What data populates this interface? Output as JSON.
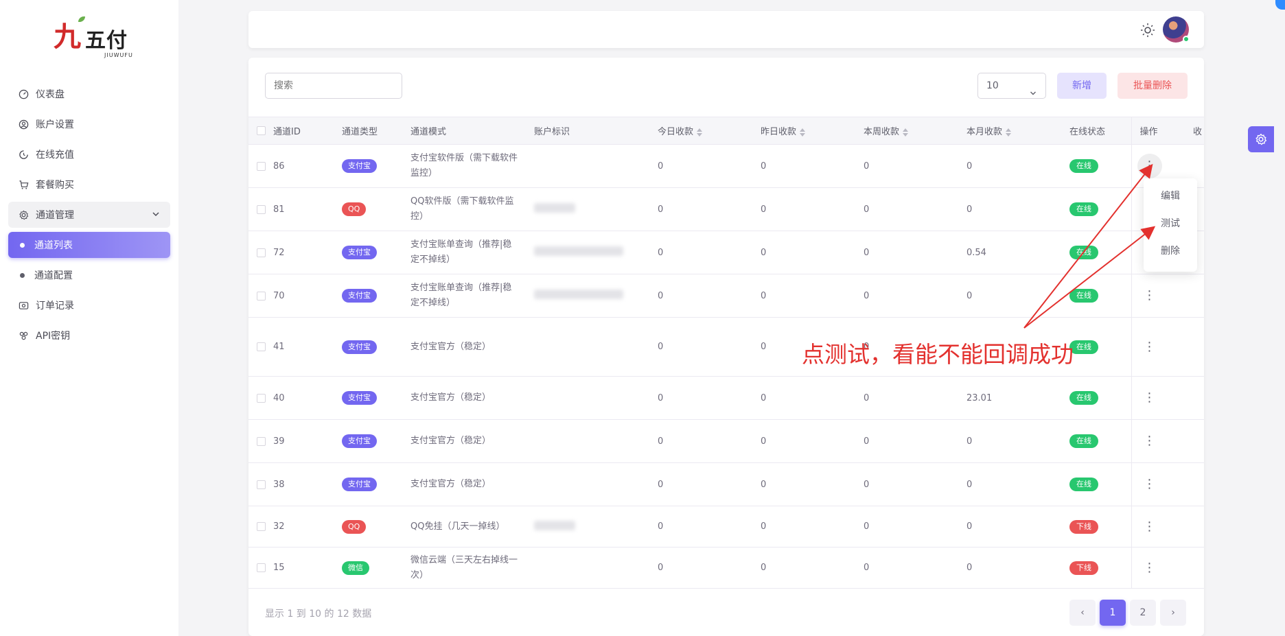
{
  "brand": {
    "mark": "九",
    "word": "五付",
    "sub": "JIUWUFU"
  },
  "sidebar": {
    "items": [
      {
        "label": "仪表盘",
        "icon": "dashboard-icon"
      },
      {
        "label": "账户设置",
        "icon": "user-icon"
      },
      {
        "label": "在线充值",
        "icon": "recharge-icon"
      },
      {
        "label": "套餐购买",
        "icon": "cart-icon"
      },
      {
        "label": "通道管理",
        "icon": "settings-icon"
      },
      {
        "label": "通道列表",
        "icon": "dot-icon"
      },
      {
        "label": "通道配置",
        "icon": "dot-icon"
      },
      {
        "label": "订单记录",
        "icon": "order-icon"
      },
      {
        "label": "API密钥",
        "icon": "api-icon"
      }
    ]
  },
  "toolbar": {
    "search_placeholder": "搜索",
    "page_size": "10",
    "add_label": "新增",
    "batch_delete_label": "批量删除"
  },
  "table": {
    "headers": {
      "id": "通道ID",
      "type": "通道类型",
      "mode": "通道模式",
      "account": "账户标识",
      "today": "今日收款",
      "yesterday": "昨日收款",
      "week": "本周收款",
      "month": "本月收款",
      "status": "在线状态",
      "action": "操作",
      "extra": "收"
    },
    "rows": [
      {
        "id": "86",
        "type": "支付宝",
        "mode": "支付宝软件版（需下载软件监控）",
        "today": "0",
        "yesterday": "0",
        "week": "0",
        "month": "0",
        "status": "在线"
      },
      {
        "id": "81",
        "type": "QQ",
        "mode": "QQ软件版（需下载软件监控）",
        "today": "0",
        "yesterday": "0",
        "week": "0",
        "month": "0",
        "status": "在线"
      },
      {
        "id": "72",
        "type": "支付宝",
        "mode": "支付宝账单查询（推荐|稳定不掉线）",
        "today": "0",
        "yesterday": "0",
        "week": "0",
        "month": "0.54",
        "status": "在线"
      },
      {
        "id": "70",
        "type": "支付宝",
        "mode": "支付宝账单查询（推荐|稳定不掉线）",
        "today": "0",
        "yesterday": "0",
        "week": "0",
        "month": "0",
        "status": "在线"
      },
      {
        "id": "41",
        "type": "支付宝",
        "mode": "支付宝官方（稳定）",
        "today": "0",
        "yesterday": "0",
        "week": "0",
        "month": "",
        "status": "在线"
      },
      {
        "id": "40",
        "type": "支付宝",
        "mode": "支付宝官方（稳定）",
        "today": "0",
        "yesterday": "0",
        "week": "0",
        "month": "23.01",
        "status": "在线"
      },
      {
        "id": "39",
        "type": "支付宝",
        "mode": "支付宝官方（稳定）",
        "today": "0",
        "yesterday": "0",
        "week": "0",
        "month": "0",
        "status": "在线"
      },
      {
        "id": "38",
        "type": "支付宝",
        "mode": "支付宝官方（稳定）",
        "today": "0",
        "yesterday": "0",
        "week": "0",
        "month": "0",
        "status": "在线"
      },
      {
        "id": "32",
        "type": "QQ",
        "mode": "QQ免挂（几天一掉线）",
        "today": "0",
        "yesterday": "0",
        "week": "0",
        "month": "0",
        "status": "下线"
      },
      {
        "id": "15",
        "type": "微信",
        "mode": "微信云端（三天左右掉线一次）",
        "today": "0",
        "yesterday": "0",
        "week": "0",
        "month": "0",
        "status": "下线"
      }
    ]
  },
  "dropdown": {
    "edit": "编辑",
    "test": "测试",
    "delete": "删除"
  },
  "footer": {
    "summary": "显示 1 到 10 的 12 数据",
    "pages": [
      "1",
      "2"
    ],
    "prev": "‹",
    "next": "›"
  },
  "annotation": {
    "text": "点测试，看能不能回调成功"
  },
  "colors": {
    "primary": "#7367f0",
    "success": "#28c76f",
    "danger": "#ea5455",
    "annotation": "#e3312e"
  }
}
